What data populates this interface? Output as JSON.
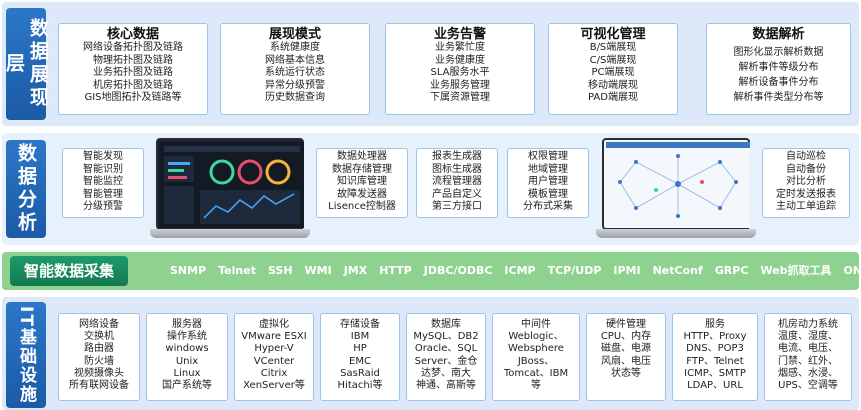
{
  "layers": {
    "presentation": {
      "label": "数据展现层",
      "boxes": [
        {
          "title": "核心数据",
          "lines": [
            "网络设备拓扑图及链路",
            "物理拓扑图及链路",
            "业务拓扑图及链路",
            "机房拓扑图及链路",
            "GIS地图拓扑及链路等"
          ]
        },
        {
          "title": "展现模式",
          "lines": [
            "系统健康度",
            "网络基本信息",
            "系统运行状态",
            "异常分级预警",
            "历史数据查询"
          ]
        },
        {
          "title": "业务告警",
          "lines": [
            "业务繁忙度",
            "业务健康度",
            "SLA服务水平",
            "业务服务管理",
            "下属资源管理"
          ]
        },
        {
          "title": "可视化管理",
          "lines": [
            "B/S端展现",
            "C/S端展现",
            "PC端展现",
            "移动端展现",
            "PAD端展现"
          ]
        },
        {
          "title": "数据解析",
          "lines": [
            "图形化显示解析数据",
            "解析事件等级分布",
            "解析设备事件分布",
            "解析事件类型分布等"
          ]
        }
      ]
    },
    "analysis": {
      "label": "数据分析",
      "boxes": [
        {
          "lines": [
            "智能发现",
            "智能识别",
            "智能监控",
            "智能管理",
            "分级预警"
          ]
        },
        {
          "lines": [
            "数据处理器",
            "数据存储管理",
            "知识库管理",
            "故障发送器",
            "Lisence控制器"
          ]
        },
        {
          "lines": [
            "报表生成器",
            "图标生成器",
            "流程管理器",
            "产品自定义",
            "第三方接口"
          ]
        },
        {
          "lines": [
            "权限管理",
            "地域管理",
            "用户管理",
            "模板管理",
            "分布式采集"
          ]
        },
        {
          "lines": [
            "自动巡检",
            "自动备份",
            "对比分析",
            "定时发送报表",
            "主动工单追踪"
          ]
        }
      ]
    },
    "collection": {
      "label": "智能数据采集",
      "items": [
        "SNMP",
        "Telnet",
        "SSH",
        "WMI",
        "JMX",
        "HTTP",
        "JDBC/ODBC",
        "ICMP",
        "TCP/UDP",
        "IPMI",
        "NetConf",
        "GRPC",
        "Web抓取工具",
        "ONVIF"
      ]
    },
    "infrastructure": {
      "label": "IT基础设施",
      "boxes": [
        {
          "lines": [
            "网络设备",
            "交换机",
            "路由器",
            "防火墙",
            "视频摄像头",
            "所有联网设备"
          ]
        },
        {
          "lines": [
            "服务器",
            "操作系统",
            "windows",
            "Unix",
            "Linux",
            "国产系统等"
          ]
        },
        {
          "lines": [
            "虚拟化",
            "VMware ESXI",
            "Hyper-V",
            "VCenter",
            "Citrix",
            "XenServer等"
          ]
        },
        {
          "lines": [
            "存储设备",
            "IBM",
            "HP",
            "EMC",
            "SasRaid",
            "Hitachi等"
          ]
        },
        {
          "lines": [
            "数据库",
            "MySQL、DB2",
            "Oracle、SQL",
            "Server、金仓",
            "达梦、南大",
            "神通、高斯等"
          ]
        },
        {
          "lines": [
            "中间件",
            "Weblogic、",
            "Websphere",
            "JBoss、",
            "Tomcat、IBM",
            "等"
          ]
        },
        {
          "lines": [
            "硬件管理",
            "CPU、内存",
            "磁盘、电源",
            "风扇、电压",
            "状态等"
          ]
        },
        {
          "lines": [
            "服务",
            "HTTP、Proxy",
            "DNS、POP3",
            "FTP、Telnet",
            "ICMP、SMTP",
            "LDAP、URL"
          ]
        },
        {
          "lines": [
            "机房动力系统",
            "温度、湿度、",
            "电流、电压、",
            "门禁、红外、",
            "烟感、水浸、",
            "UPS、空调等"
          ]
        }
      ]
    }
  },
  "colors": {
    "layer_bg": "#dde9f8",
    "side_label": "#1b5aa6",
    "box_border": "#9cc3e8",
    "collection_band": "#8fd18e",
    "collection_title": "#137a50",
    "dashboard_dark": "#1b1f27"
  },
  "icons": [
    "laptop-dashboard-icon",
    "laptop-topology-icon"
  ]
}
